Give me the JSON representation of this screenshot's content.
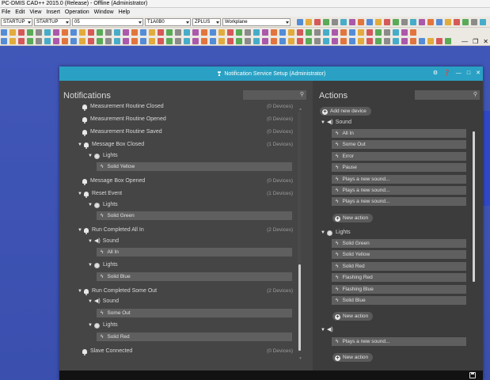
{
  "app": {
    "title": "PC-DMIS CAD++ 2015.0 (Release) - Offline (Administrator)",
    "menu": [
      "File",
      "Edit",
      "View",
      "Insert",
      "Operation",
      "Window",
      "Help"
    ],
    "toolbar_combos": [
      "STARTUP",
      "STARTUP",
      "05",
      "T1A0B0",
      "ZPLUS",
      "Workplane"
    ]
  },
  "dialog": {
    "title": "Notification Service Setup (Administrator)",
    "notifications": {
      "heading": "Notifications",
      "rows": [
        {
          "label": "Measurement Routine Closed",
          "count": "(0 Devices)"
        },
        {
          "label": "Measurement Routine Opened",
          "count": "(0 Devices)"
        },
        {
          "label": "Measurement Routine Saved",
          "count": "(0 Devices)"
        },
        {
          "label": "Message Box Closed",
          "count": "(1 Devices)"
        },
        {
          "label": "Lights"
        },
        {
          "label": "Solid Yellow"
        },
        {
          "label": "Message Box Opened",
          "count": "(0 Devices)"
        },
        {
          "label": "Reset Event",
          "count": "(1 Devices)"
        },
        {
          "label": "Lights"
        },
        {
          "label": "Solid Green"
        },
        {
          "label": "Run Completed All In",
          "count": "(2 Devices)"
        },
        {
          "label": "Sound"
        },
        {
          "label": "All In"
        },
        {
          "label": "Lights"
        },
        {
          "label": "Solid Blue"
        },
        {
          "label": "Run Completed Some Out",
          "count": "(2 Devices)"
        },
        {
          "label": "Sound"
        },
        {
          "label": "Some Out"
        },
        {
          "label": "Lights"
        },
        {
          "label": "Solid Red"
        },
        {
          "label": "Slave Connected",
          "count": "(0 Devices)"
        }
      ]
    },
    "actions": {
      "heading": "Actions",
      "add_device": "Add new device",
      "sound_group": "Sound",
      "sound_items": [
        "All In",
        "Some Out",
        "Error",
        "Pause",
        "Plays a new sound...",
        "Plays a new sound...",
        "Plays a new sound..."
      ],
      "new_action": "New action",
      "lights_group": "Lights",
      "lights_items": [
        "Solid Green",
        "Solid Yellow",
        "Solid Red",
        "Flashing Red",
        "Flashing Blue",
        "Solid Blue"
      ],
      "third_items": [
        "Plays a new sound..."
      ]
    }
  }
}
